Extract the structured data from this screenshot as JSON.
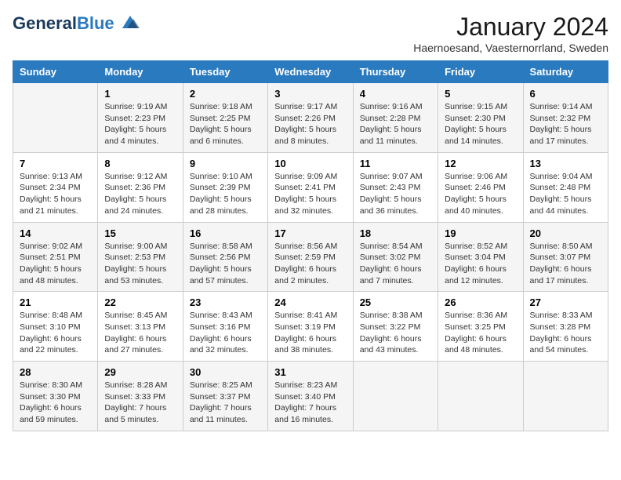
{
  "logo": {
    "line1": "General",
    "line2": "Blue"
  },
  "title": "January 2024",
  "location": "Haernoesand, Vaesternorrland, Sweden",
  "headers": [
    "Sunday",
    "Monday",
    "Tuesday",
    "Wednesday",
    "Thursday",
    "Friday",
    "Saturday"
  ],
  "weeks": [
    [
      {
        "day": "",
        "info": ""
      },
      {
        "day": "1",
        "info": "Sunrise: 9:19 AM\nSunset: 2:23 PM\nDaylight: 5 hours\nand 4 minutes."
      },
      {
        "day": "2",
        "info": "Sunrise: 9:18 AM\nSunset: 2:25 PM\nDaylight: 5 hours\nand 6 minutes."
      },
      {
        "day": "3",
        "info": "Sunrise: 9:17 AM\nSunset: 2:26 PM\nDaylight: 5 hours\nand 8 minutes."
      },
      {
        "day": "4",
        "info": "Sunrise: 9:16 AM\nSunset: 2:28 PM\nDaylight: 5 hours\nand 11 minutes."
      },
      {
        "day": "5",
        "info": "Sunrise: 9:15 AM\nSunset: 2:30 PM\nDaylight: 5 hours\nand 14 minutes."
      },
      {
        "day": "6",
        "info": "Sunrise: 9:14 AM\nSunset: 2:32 PM\nDaylight: 5 hours\nand 17 minutes."
      }
    ],
    [
      {
        "day": "7",
        "info": "Sunrise: 9:13 AM\nSunset: 2:34 PM\nDaylight: 5 hours\nand 21 minutes."
      },
      {
        "day": "8",
        "info": "Sunrise: 9:12 AM\nSunset: 2:36 PM\nDaylight: 5 hours\nand 24 minutes."
      },
      {
        "day": "9",
        "info": "Sunrise: 9:10 AM\nSunset: 2:39 PM\nDaylight: 5 hours\nand 28 minutes."
      },
      {
        "day": "10",
        "info": "Sunrise: 9:09 AM\nSunset: 2:41 PM\nDaylight: 5 hours\nand 32 minutes."
      },
      {
        "day": "11",
        "info": "Sunrise: 9:07 AM\nSunset: 2:43 PM\nDaylight: 5 hours\nand 36 minutes."
      },
      {
        "day": "12",
        "info": "Sunrise: 9:06 AM\nSunset: 2:46 PM\nDaylight: 5 hours\nand 40 minutes."
      },
      {
        "day": "13",
        "info": "Sunrise: 9:04 AM\nSunset: 2:48 PM\nDaylight: 5 hours\nand 44 minutes."
      }
    ],
    [
      {
        "day": "14",
        "info": "Sunrise: 9:02 AM\nSunset: 2:51 PM\nDaylight: 5 hours\nand 48 minutes."
      },
      {
        "day": "15",
        "info": "Sunrise: 9:00 AM\nSunset: 2:53 PM\nDaylight: 5 hours\nand 53 minutes."
      },
      {
        "day": "16",
        "info": "Sunrise: 8:58 AM\nSunset: 2:56 PM\nDaylight: 5 hours\nand 57 minutes."
      },
      {
        "day": "17",
        "info": "Sunrise: 8:56 AM\nSunset: 2:59 PM\nDaylight: 6 hours\nand 2 minutes."
      },
      {
        "day": "18",
        "info": "Sunrise: 8:54 AM\nSunset: 3:02 PM\nDaylight: 6 hours\nand 7 minutes."
      },
      {
        "day": "19",
        "info": "Sunrise: 8:52 AM\nSunset: 3:04 PM\nDaylight: 6 hours\nand 12 minutes."
      },
      {
        "day": "20",
        "info": "Sunrise: 8:50 AM\nSunset: 3:07 PM\nDaylight: 6 hours\nand 17 minutes."
      }
    ],
    [
      {
        "day": "21",
        "info": "Sunrise: 8:48 AM\nSunset: 3:10 PM\nDaylight: 6 hours\nand 22 minutes."
      },
      {
        "day": "22",
        "info": "Sunrise: 8:45 AM\nSunset: 3:13 PM\nDaylight: 6 hours\nand 27 minutes."
      },
      {
        "day": "23",
        "info": "Sunrise: 8:43 AM\nSunset: 3:16 PM\nDaylight: 6 hours\nand 32 minutes."
      },
      {
        "day": "24",
        "info": "Sunrise: 8:41 AM\nSunset: 3:19 PM\nDaylight: 6 hours\nand 38 minutes."
      },
      {
        "day": "25",
        "info": "Sunrise: 8:38 AM\nSunset: 3:22 PM\nDaylight: 6 hours\nand 43 minutes."
      },
      {
        "day": "26",
        "info": "Sunrise: 8:36 AM\nSunset: 3:25 PM\nDaylight: 6 hours\nand 48 minutes."
      },
      {
        "day": "27",
        "info": "Sunrise: 8:33 AM\nSunset: 3:28 PM\nDaylight: 6 hours\nand 54 minutes."
      }
    ],
    [
      {
        "day": "28",
        "info": "Sunrise: 8:30 AM\nSunset: 3:30 PM\nDaylight: 6 hours\nand 59 minutes."
      },
      {
        "day": "29",
        "info": "Sunrise: 8:28 AM\nSunset: 3:33 PM\nDaylight: 7 hours\nand 5 minutes."
      },
      {
        "day": "30",
        "info": "Sunrise: 8:25 AM\nSunset: 3:37 PM\nDaylight: 7 hours\nand 11 minutes."
      },
      {
        "day": "31",
        "info": "Sunrise: 8:23 AM\nSunset: 3:40 PM\nDaylight: 7 hours\nand 16 minutes."
      },
      {
        "day": "",
        "info": ""
      },
      {
        "day": "",
        "info": ""
      },
      {
        "day": "",
        "info": ""
      }
    ]
  ]
}
